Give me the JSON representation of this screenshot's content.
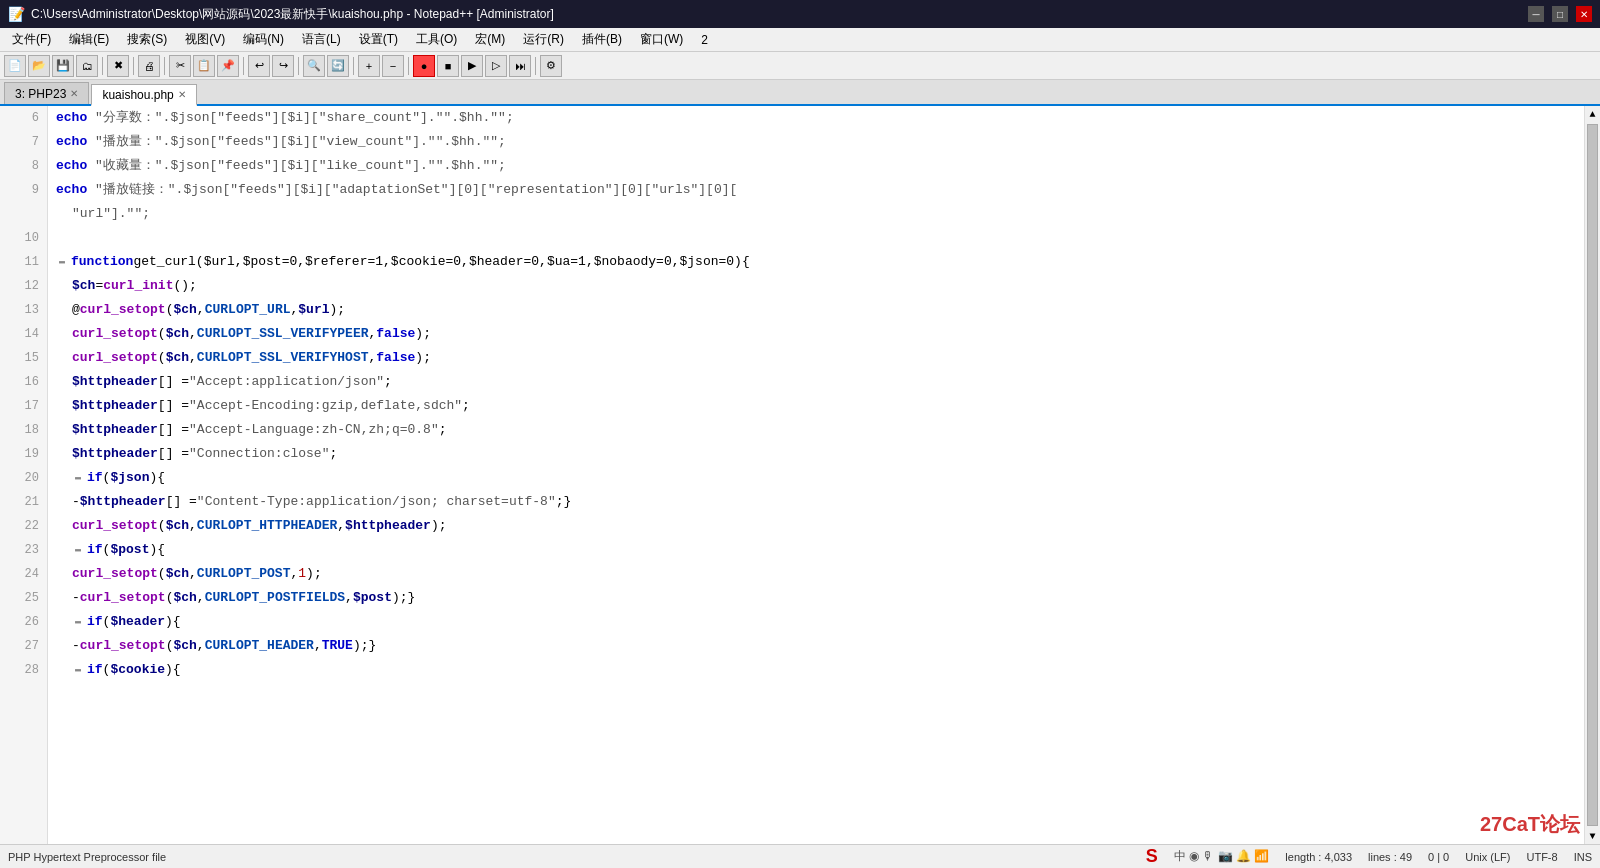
{
  "titlebar": {
    "title": "C:\\Users\\Administrator\\Desktop\\网站源码\\2023最新快手\\kuaishou.php - Notepad++ [Administrator]",
    "min_label": "─",
    "max_label": "□",
    "close_label": "✕",
    "close_x_label": "✕"
  },
  "menubar": {
    "items": [
      {
        "label": "文件(F)"
      },
      {
        "label": "编辑(E)"
      },
      {
        "label": "搜索(S)"
      },
      {
        "label": "视图(V)"
      },
      {
        "label": "编码(N)"
      },
      {
        "label": "语言(L)"
      },
      {
        "label": "设置(T)"
      },
      {
        "label": "工具(O)"
      },
      {
        "label": "宏(M)"
      },
      {
        "label": "运行(R)"
      },
      {
        "label": "插件(B)"
      },
      {
        "label": "窗口(W)"
      },
      {
        "label": "2"
      }
    ]
  },
  "tabs": [
    {
      "label": "3: PHP23",
      "active": false,
      "closable": true
    },
    {
      "label": "kuaishou.php",
      "active": true,
      "closable": true
    }
  ],
  "code": {
    "lines": [
      {
        "num": 6,
        "fold": false,
        "tokens": [
          {
            "t": "kw-echo",
            "v": "echo"
          },
          {
            "t": "normal",
            "v": " "
          },
          {
            "t": "str-text",
            "v": "\"分享数：\"."
          },
          {
            "t": "var-text",
            "v": "$json"
          },
          {
            "t": "normal",
            "v": "[\"feeds\"][$i][\"share_count\"].\"\".$hh.\"\";​"
          }
        ]
      },
      {
        "num": 7,
        "fold": false,
        "tokens": [
          {
            "t": "kw-echo",
            "v": "echo"
          },
          {
            "t": "normal",
            "v": " "
          },
          {
            "t": "str-text",
            "v": "\"播放量：\"."
          },
          {
            "t": "var-text",
            "v": "$json"
          },
          {
            "t": "normal",
            "v": "[\"feeds\"][$i][\"view_count\"].\"\".$hh.\"\";"
          }
        ]
      },
      {
        "num": 8,
        "fold": false,
        "tokens": [
          {
            "t": "kw-echo",
            "v": "echo"
          },
          {
            "t": "normal",
            "v": " "
          },
          {
            "t": "str-text",
            "v": "\"收藏量：\"."
          },
          {
            "t": "var-text",
            "v": "$json"
          },
          {
            "t": "normal",
            "v": "[\"feeds\"][$i][\"like_count\"].\"\".$hh.\"\";"
          }
        ]
      },
      {
        "num": 9,
        "fold": false,
        "tokens": [
          {
            "t": "kw-echo",
            "v": "echo"
          },
          {
            "t": "normal",
            "v": " "
          },
          {
            "t": "str-text",
            "v": "\"播放链接：\"."
          },
          {
            "t": "var-text",
            "v": "$json"
          },
          {
            "t": "normal",
            "v": "[\"feeds\"][$i][\"adaptationSet\"][0][\"representation\"][0][\"urls\"][0]["
          }
        ]
      },
      {
        "num": 9,
        "fold": false,
        "tokens": [
          {
            "t": "str-text",
            "v": "\"url\"].\"\";"
          }
        ],
        "indent": 0,
        "continuation": true
      },
      {
        "num": 10,
        "fold": false,
        "tokens": []
      },
      {
        "num": 11,
        "fold": true,
        "tokens": [
          {
            "t": "kw-function",
            "v": "function"
          },
          {
            "t": "fn-name",
            "v": " get_curl"
          },
          {
            "t": "normal",
            "v": "($url,$post=0,$referer=1,$cookie=0,$header=0,$ua=1,$nobaody=0,$json=0){"
          }
        ]
      },
      {
        "num": 12,
        "fold": false,
        "tokens": [
          {
            "t": "var-text",
            "v": "$ch"
          },
          {
            "t": "normal",
            "v": " = "
          },
          {
            "t": "kw-curl",
            "v": "curl_init"
          },
          {
            "t": "normal",
            "v": "();"
          }
        ]
      },
      {
        "num": 13,
        "fold": false,
        "tokens": [
          {
            "t": "normal",
            "v": "@"
          },
          {
            "t": "kw-curl",
            "v": "curl_setopt"
          },
          {
            "t": "normal",
            "v": "("
          },
          {
            "t": "var-text",
            "v": "$ch"
          },
          {
            "t": "normal",
            "v": ", "
          },
          {
            "t": "kw-curlopt",
            "v": "CURLOPT_URL"
          },
          {
            "t": "normal",
            "v": ","
          },
          {
            "t": "var-text",
            "v": "$url"
          },
          {
            "t": "normal",
            "v": ");"
          }
        ]
      },
      {
        "num": 14,
        "fold": false,
        "tokens": [
          {
            "t": "kw-curl",
            "v": "curl_setopt"
          },
          {
            "t": "normal",
            "v": "("
          },
          {
            "t": "var-text",
            "v": "$ch"
          },
          {
            "t": "normal",
            "v": ", "
          },
          {
            "t": "kw-curlopt",
            "v": "CURLOPT_SSL_VERIFYPEER"
          },
          {
            "t": "normal",
            "v": ", "
          },
          {
            "t": "kw-false",
            "v": "false"
          },
          {
            "t": "normal",
            "v": ");"
          }
        ]
      },
      {
        "num": 15,
        "fold": false,
        "tokens": [
          {
            "t": "kw-curl",
            "v": "curl_setopt"
          },
          {
            "t": "normal",
            "v": "("
          },
          {
            "t": "var-text",
            "v": "$ch"
          },
          {
            "t": "normal",
            "v": ", "
          },
          {
            "t": "kw-curlopt",
            "v": "CURLOPT_SSL_VERIFYHOST"
          },
          {
            "t": "normal",
            "v": ", "
          },
          {
            "t": "kw-false",
            "v": "false"
          },
          {
            "t": "normal",
            "v": ");"
          }
        ]
      },
      {
        "num": 16,
        "fold": false,
        "tokens": [
          {
            "t": "var-text",
            "v": "$httpheader"
          },
          {
            "t": "normal",
            "v": "[] = "
          },
          {
            "t": "str-text",
            "v": "\"Accept:application/json\""
          },
          {
            "t": "normal",
            "v": ";"
          }
        ]
      },
      {
        "num": 17,
        "fold": false,
        "tokens": [
          {
            "t": "var-text",
            "v": "$httpheader"
          },
          {
            "t": "normal",
            "v": "[] = "
          },
          {
            "t": "str-text",
            "v": "\"Accept-Encoding:gzip,deflate,sdch\""
          },
          {
            "t": "normal",
            "v": ";"
          }
        ]
      },
      {
        "num": 18,
        "fold": false,
        "tokens": [
          {
            "t": "var-text",
            "v": "$httpheader"
          },
          {
            "t": "normal",
            "v": "[] = "
          },
          {
            "t": "str-text",
            "v": "\"Accept-Language:zh-CN,zh;q=0.8\""
          },
          {
            "t": "normal",
            "v": ";"
          }
        ]
      },
      {
        "num": 19,
        "fold": false,
        "tokens": [
          {
            "t": "var-text",
            "v": "$httpheader"
          },
          {
            "t": "normal",
            "v": "[] = "
          },
          {
            "t": "str-text",
            "v": "\"Connection:close\""
          },
          {
            "t": "normal",
            "v": ";"
          }
        ]
      },
      {
        "num": 20,
        "fold": true,
        "tokens": [
          {
            "t": "kw-if",
            "v": "if"
          },
          {
            "t": "normal",
            "v": "("
          },
          {
            "t": "var-text",
            "v": "$json"
          },
          {
            "t": "normal",
            "v": "){"
          }
        ]
      },
      {
        "num": 21,
        "fold": false,
        "tokens": [
          {
            "t": "normal",
            "v": "-"
          },
          {
            "t": "var-text",
            "v": "$httpheader"
          },
          {
            "t": "normal",
            "v": "[] = "
          },
          {
            "t": "str-text",
            "v": "\"Content-Type:application/json; charset=utf-8\""
          },
          {
            "t": "normal",
            "v": ";}"
          }
        ]
      },
      {
        "num": 22,
        "fold": false,
        "tokens": [
          {
            "t": "kw-curl",
            "v": "curl_setopt"
          },
          {
            "t": "normal",
            "v": "("
          },
          {
            "t": "var-text",
            "v": "$ch"
          },
          {
            "t": "normal",
            "v": ", "
          },
          {
            "t": "kw-curlopt",
            "v": "CURLOPT_HTTPHEADER"
          },
          {
            "t": "normal",
            "v": ", "
          },
          {
            "t": "var-text",
            "v": "$httpheader"
          },
          {
            "t": "normal",
            "v": ");"
          }
        ]
      },
      {
        "num": 23,
        "fold": true,
        "tokens": [
          {
            "t": "kw-if",
            "v": "if"
          },
          {
            "t": "normal",
            "v": "("
          },
          {
            "t": "var-text",
            "v": "$post"
          },
          {
            "t": "normal",
            "v": "){"
          }
        ]
      },
      {
        "num": 24,
        "fold": false,
        "tokens": [
          {
            "t": "kw-curl",
            "v": "curl_setopt"
          },
          {
            "t": "normal",
            "v": "("
          },
          {
            "t": "var-text",
            "v": "$ch"
          },
          {
            "t": "normal",
            "v": ", "
          },
          {
            "t": "kw-curlopt",
            "v": "CURLOPT_POST"
          },
          {
            "t": "normal",
            "v": ", "
          },
          {
            "t": "num",
            "v": "1"
          },
          {
            "t": "normal",
            "v": ");"
          }
        ]
      },
      {
        "num": 25,
        "fold": false,
        "tokens": [
          {
            "t": "normal",
            "v": "-"
          },
          {
            "t": "kw-curl",
            "v": "curl_setopt"
          },
          {
            "t": "normal",
            "v": "("
          },
          {
            "t": "var-text",
            "v": "$ch"
          },
          {
            "t": "normal",
            "v": ", "
          },
          {
            "t": "kw-curlopt",
            "v": "CURLOPT_POSTFIELDS"
          },
          {
            "t": "normal",
            "v": ", "
          },
          {
            "t": "var-text",
            "v": "$post"
          },
          {
            "t": "normal",
            "v": ");}"
          }
        ]
      },
      {
        "num": 26,
        "fold": true,
        "tokens": [
          {
            "t": "kw-if",
            "v": "if"
          },
          {
            "t": "normal",
            "v": "("
          },
          {
            "t": "var-text",
            "v": "$header"
          },
          {
            "t": "normal",
            "v": "){"
          }
        ]
      },
      {
        "num": 27,
        "fold": false,
        "tokens": [
          {
            "t": "normal",
            "v": "-"
          },
          {
            "t": "kw-curl",
            "v": "curl_setopt"
          },
          {
            "t": "normal",
            "v": "("
          },
          {
            "t": "var-text",
            "v": "$ch"
          },
          {
            "t": "normal",
            "v": ", "
          },
          {
            "t": "kw-curlopt",
            "v": "CURLOPT_HEADER"
          },
          {
            "t": "normal",
            "v": ", "
          },
          {
            "t": "kw-true",
            "v": "TRUE"
          },
          {
            "t": "normal",
            "v": ");}"
          }
        ]
      },
      {
        "num": 28,
        "fold": true,
        "tokens": [
          {
            "t": "kw-if",
            "v": "if"
          },
          {
            "t": "normal",
            "v": "("
          },
          {
            "t": "var-text",
            "v": "$cookie"
          },
          {
            "t": "normal",
            "v": "){"
          }
        ]
      }
    ]
  },
  "statusbar": {
    "filetype": "PHP Hypertext Preprocessor file",
    "length": "length : 4,033",
    "lines": "lines : 49",
    "pos": "0 | 0",
    "eol": "Unix (LF)",
    "encoding": "UTF-8",
    "mode": "INS",
    "watermark": "27CaT论坛"
  }
}
